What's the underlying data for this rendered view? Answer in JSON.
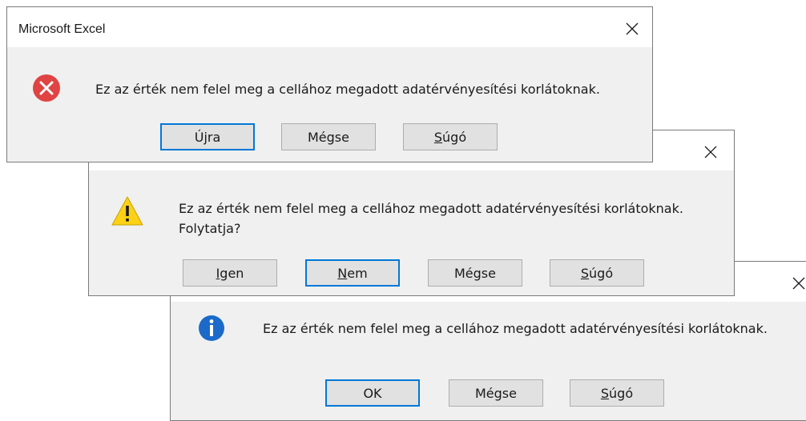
{
  "dialogs": [
    {
      "type": "error",
      "title": "Microsoft Excel",
      "close_glyph": "✕",
      "icon": "error-icon",
      "message_lines": [
        "Ez az érték nem felel meg a cellához megadott adatérvényesítési korlátoknak."
      ],
      "buttons": [
        {
          "label_pre": "Ú",
          "label_acc": "j",
          "label_post": "ra",
          "default": true
        },
        {
          "label_pre": "Mégse",
          "label_acc": "",
          "label_post": "",
          "default": false
        },
        {
          "label_pre": "",
          "label_acc": "S",
          "label_post": "úgó",
          "default": false
        }
      ]
    },
    {
      "type": "warning",
      "title": "",
      "close_glyph": "✕",
      "icon": "warning-icon",
      "message_lines": [
        "Ez az érték nem felel meg a cellához megadott adatérvényesítési korlátoknak.",
        "Folytatja?"
      ],
      "buttons": [
        {
          "label_pre": "",
          "label_acc": "I",
          "label_post": "gen",
          "default": false
        },
        {
          "label_pre": "",
          "label_acc": "N",
          "label_post": "em",
          "default": true
        },
        {
          "label_pre": "Mégse",
          "label_acc": "",
          "label_post": "",
          "default": false
        },
        {
          "label_pre": "",
          "label_acc": "S",
          "label_post": "úgó",
          "default": false
        }
      ]
    },
    {
      "type": "information",
      "title": "",
      "close_glyph": "✕",
      "icon": "info-icon",
      "message_lines": [
        "Ez az érték nem felel meg a cellához megadott adatérvényesítési korlátoknak."
      ],
      "buttons": [
        {
          "label_pre": "OK",
          "label_acc": "",
          "label_post": "",
          "default": true
        },
        {
          "label_pre": "Mégse",
          "label_acc": "",
          "label_post": "",
          "default": false
        },
        {
          "label_pre": "",
          "label_acc": "S",
          "label_post": "úgó",
          "default": false
        }
      ]
    }
  ],
  "colors": {
    "error_red": "#e04343",
    "warning_yellow": "#fcd116",
    "info_blue": "#1b6ac9",
    "focus_blue": "#0078d7"
  }
}
